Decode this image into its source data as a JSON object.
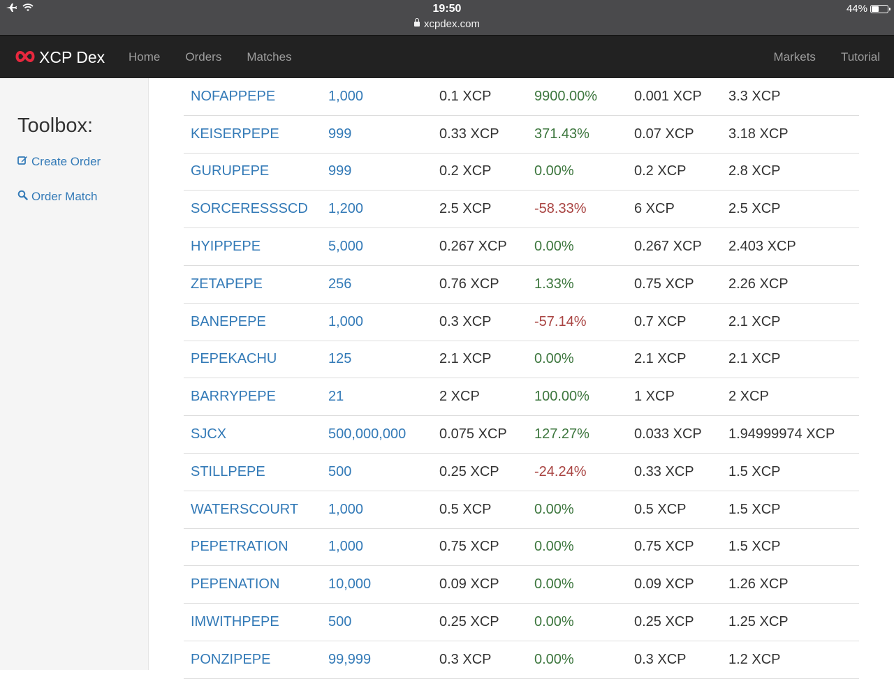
{
  "status_bar": {
    "time": "19:50",
    "url": "xcpdex.com",
    "battery": "44%",
    "battery_level": 0.44,
    "icons": [
      "airplane-icon",
      "wifi-icon",
      "lock-icon",
      "battery-icon"
    ]
  },
  "navbar": {
    "brand": "XCP Dex",
    "links": [
      "Home",
      "Orders",
      "Matches"
    ],
    "right_links": [
      "Markets",
      "Tutorial"
    ],
    "brand_color": "#e8283e"
  },
  "sidebar": {
    "title": "Toolbox:",
    "links": [
      {
        "label": "Create Order",
        "icon": "edit-icon"
      },
      {
        "label": "Order Match",
        "icon": "search-icon"
      }
    ]
  },
  "colors": {
    "link": "#337ab7",
    "positive": "#3c763d",
    "negative": "#a94442"
  },
  "table": {
    "rows": [
      {
        "name": "NOFAPPEPE",
        "supply": "1,000",
        "price": "0.1 XCP",
        "change": "9900.00%",
        "prev": "0.001 XCP",
        "cap": "3.3 XCP"
      },
      {
        "name": "KEISERPEPE",
        "supply": "999",
        "price": "0.33 XCP",
        "change": "371.43%",
        "prev": "0.07 XCP",
        "cap": "3.18 XCP"
      },
      {
        "name": "GURUPEPE",
        "supply": "999",
        "price": "0.2 XCP",
        "change": "0.00%",
        "prev": "0.2 XCP",
        "cap": "2.8 XCP"
      },
      {
        "name": "SORCERESSSCD",
        "supply": "1,200",
        "price": "2.5 XCP",
        "change": "-58.33%",
        "prev": "6 XCP",
        "cap": "2.5 XCP"
      },
      {
        "name": "HYIPPEPE",
        "supply": "5,000",
        "price": "0.267 XCP",
        "change": "0.00%",
        "prev": "0.267 XCP",
        "cap": "2.403 XCP"
      },
      {
        "name": "ZETAPEPE",
        "supply": "256",
        "price": "0.76 XCP",
        "change": "1.33%",
        "prev": "0.75 XCP",
        "cap": "2.26 XCP"
      },
      {
        "name": "BANEPEPE",
        "supply": "1,000",
        "price": "0.3 XCP",
        "change": "-57.14%",
        "prev": "0.7 XCP",
        "cap": "2.1 XCP"
      },
      {
        "name": "PEPEKACHU",
        "supply": "125",
        "price": "2.1 XCP",
        "change": "0.00%",
        "prev": "2.1 XCP",
        "cap": "2.1 XCP"
      },
      {
        "name": "BARRYPEPE",
        "supply": "21",
        "price": "2 XCP",
        "change": "100.00%",
        "prev": "1 XCP",
        "cap": "2 XCP"
      },
      {
        "name": "SJCX",
        "supply": "500,000,000",
        "price": "0.075 XCP",
        "change": "127.27%",
        "prev": "0.033 XCP",
        "cap": "1.94999974 XCP"
      },
      {
        "name": "STILLPEPE",
        "supply": "500",
        "price": "0.25 XCP",
        "change": "-24.24%",
        "prev": "0.33 XCP",
        "cap": "1.5 XCP"
      },
      {
        "name": "WATERSCOURT",
        "supply": "1,000",
        "price": "0.5 XCP",
        "change": "0.00%",
        "prev": "0.5 XCP",
        "cap": "1.5 XCP"
      },
      {
        "name": "PEPETRATION",
        "supply": "1,000",
        "price": "0.75 XCP",
        "change": "0.00%",
        "prev": "0.75 XCP",
        "cap": "1.5 XCP"
      },
      {
        "name": "PEPENATION",
        "supply": "10,000",
        "price": "0.09 XCP",
        "change": "0.00%",
        "prev": "0.09 XCP",
        "cap": "1.26 XCP"
      },
      {
        "name": "IMWITHPEPE",
        "supply": "500",
        "price": "0.25 XCP",
        "change": "0.00%",
        "prev": "0.25 XCP",
        "cap": "1.25 XCP"
      },
      {
        "name": "PONZIPEPE",
        "supply": "99,999",
        "price": "0.3 XCP",
        "change": "0.00%",
        "prev": "0.3 XCP",
        "cap": "1.2 XCP"
      }
    ]
  }
}
